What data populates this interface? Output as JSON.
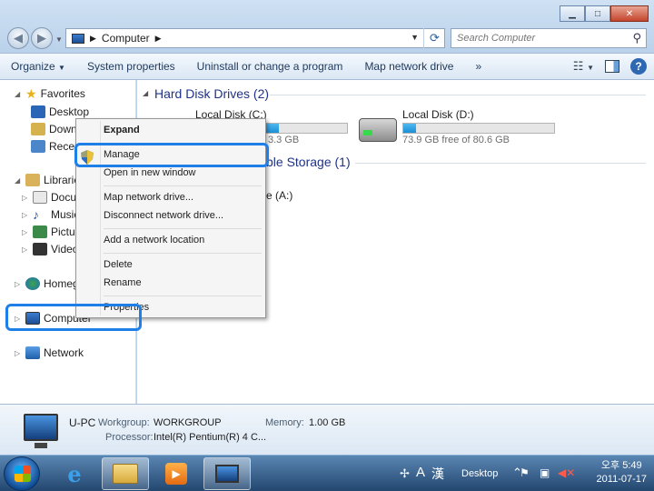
{
  "window": {
    "address_path": "Computer",
    "search_placeholder": "Search Computer"
  },
  "toolbar": {
    "organize": "Organize",
    "system_properties": "System properties",
    "uninstall": "Uninstall or change a program",
    "map_network_drive": "Map network drive",
    "more": "»"
  },
  "nav": {
    "favorites": "Favorites",
    "desktop": "Desktop",
    "downloads": "Downl",
    "recent": "Recen",
    "libraries": "Libraries",
    "documents": "Docur",
    "music": "Music",
    "pictures": "Pictur",
    "videos": "Video",
    "homegroup": "Homegr",
    "computer": "Computer",
    "network": "Network"
  },
  "content": {
    "hard_disk_header": "Hard Disk Drives (2)",
    "removable_header_partial": "ble Storage (1)",
    "drive_c_name": "Local Disk (C:)",
    "drive_c_free_partial": "3.3 GB",
    "drive_d_name": "Local Disk (D:)",
    "drive_d_free": "73.9 GB free of 80.6 GB",
    "drive_a_partial": "e (A:)",
    "drive_d_used_fraction": 0.083,
    "drive_c_used_fraction": 0.55
  },
  "context_menu": {
    "expand": "Expand",
    "manage": "Manage",
    "open_new_window": "Open in new window",
    "map_network_drive": "Map network drive...",
    "disconnect_network_drive": "Disconnect network drive...",
    "add_network_location": "Add a network location",
    "delete": "Delete",
    "rename": "Rename",
    "properties": "Properties"
  },
  "details": {
    "name": "U-PC",
    "workgroup_label": "Workgroup:",
    "workgroup_value": "WORKGROUP",
    "memory_label": "Memory:",
    "memory_value": "1.00 GB",
    "processor_label": "Processor:",
    "processor_value": "Intel(R) Pentium(R) 4 C..."
  },
  "taskbar": {
    "desktop_label": "Desktop",
    "ime_a": "A",
    "ime_han": "漢",
    "clock_time": "오후 5:49",
    "clock_date": "2011-07-17"
  },
  "colors": {
    "highlight": "#1e7fe8",
    "group_header": "#1e3287"
  }
}
